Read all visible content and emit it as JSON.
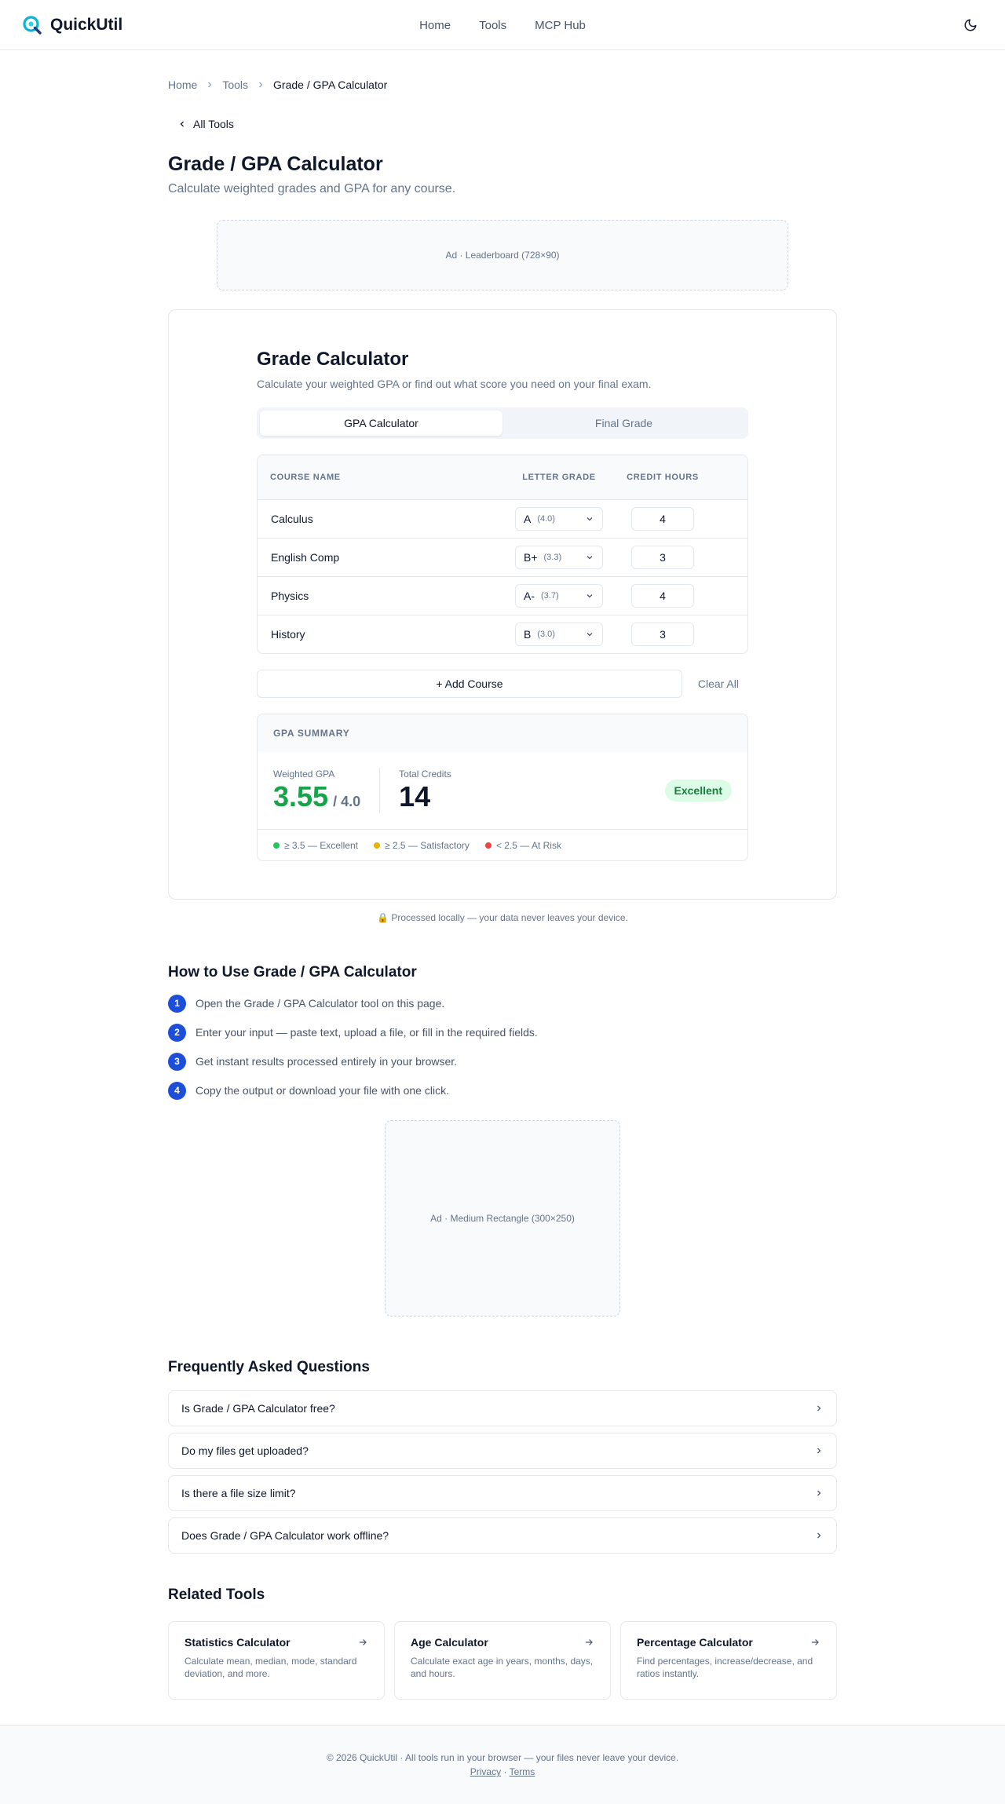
{
  "header": {
    "brand": "QuickUtil",
    "nav": [
      "Home",
      "Tools",
      "MCP Hub"
    ]
  },
  "breadcrumb": {
    "home": "Home",
    "tools": "Tools",
    "current": "Grade / GPA Calculator"
  },
  "back_link": "All Tools",
  "page": {
    "title": "Grade / GPA Calculator",
    "subtitle": "Calculate weighted grades and GPA for any course."
  },
  "ads": {
    "leaderboard": "Ad · Leaderboard (728×90)",
    "rectangle": "Ad · Medium Rectangle (300×250)"
  },
  "calculator": {
    "title": "Grade Calculator",
    "subtitle": "Calculate your weighted GPA or find out what score you need on your final exam.",
    "tabs": [
      "GPA Calculator",
      "Final Grade"
    ],
    "active_tab": "GPA Calculator",
    "columns": {
      "name": "Course Name",
      "grade": "Letter Grade",
      "hours": "Credit Hours"
    },
    "courses": [
      {
        "name": "Calculus",
        "letter": "A",
        "points": "(4.0)",
        "hours": "4"
      },
      {
        "name": "English Comp",
        "letter": "B+",
        "points": "(3.3)",
        "hours": "3"
      },
      {
        "name": "Physics",
        "letter": "A-",
        "points": "(3.7)",
        "hours": "4"
      },
      {
        "name": "History",
        "letter": "B",
        "points": "(3.0)",
        "hours": "3"
      }
    ],
    "add_label": "+ Add Course",
    "clear_label": "Clear All",
    "summary": {
      "heading": "GPA Summary",
      "gpa_label": "Weighted GPA",
      "gpa_value": "3.55",
      "gpa_max": "/ 4.0",
      "credits_label": "Total Credits",
      "credits_value": "14",
      "status": "Excellent",
      "legend": [
        {
          "label": "≥ 3.5 — Excellent",
          "color": "#22c55e"
        },
        {
          "label": "≥ 2.5 — Satisfactory",
          "color": "#eab308"
        },
        {
          "label": "< 2.5 — At Risk",
          "color": "#ef4444"
        }
      ]
    }
  },
  "privacy_note": "🔒 Processed locally — your data never leaves your device.",
  "howto": {
    "title": "How to Use Grade / GPA Calculator",
    "steps": [
      {
        "num": "1",
        "text": "Open the Grade / GPA Calculator tool on this page."
      },
      {
        "num": "2",
        "text": "Enter your input — paste text, upload a file, or fill in the required fields."
      },
      {
        "num": "3",
        "text": "Get instant results processed entirely in your browser."
      },
      {
        "num": "4",
        "text": "Copy the output or download your file with one click."
      }
    ]
  },
  "faq": {
    "title": "Frequently Asked Questions",
    "items": [
      "Is Grade / GPA Calculator free?",
      "Do my files get uploaded?",
      "Is there a file size limit?",
      "Does Grade / GPA Calculator work offline?"
    ]
  },
  "related": {
    "title": "Related Tools",
    "items": [
      {
        "name": "Statistics Calculator",
        "desc": "Calculate mean, median, mode, standard deviation, and more."
      },
      {
        "name": "Age Calculator",
        "desc": "Calculate exact age in years, months, days, and hours."
      },
      {
        "name": "Percentage Calculator",
        "desc": "Find percentages, increase/decrease, and ratios instantly."
      }
    ]
  },
  "footer": {
    "text": "© 2026 QuickUtil · All tools run in your browser — your files never leave your device.",
    "privacy": "Privacy",
    "separator": "·",
    "terms": "Terms"
  },
  "colors": {
    "accent": "#1d4ed8",
    "success": "#16a34a",
    "brand_icon": "#06b6d4"
  }
}
